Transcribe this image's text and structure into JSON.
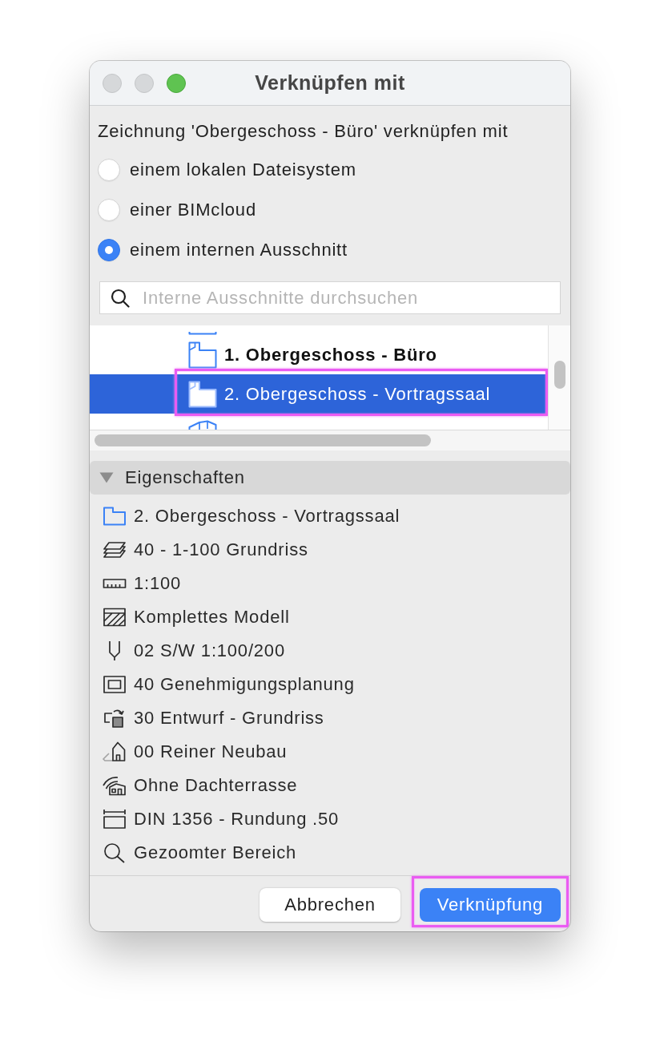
{
  "window": {
    "title": "Verknüpfen mit",
    "buttons": [
      {
        "kind": "close",
        "enabled": false
      },
      {
        "kind": "minimize",
        "enabled": false
      },
      {
        "kind": "zoom",
        "enabled": true
      }
    ]
  },
  "prompt": "Zeichnung 'Obergeschoss - Büro' verknüpfen mit",
  "link_targets": [
    {
      "label": "einem lokalen Dateisystem",
      "selected": false
    },
    {
      "label": "einer BIMcloud",
      "selected": false
    },
    {
      "label": "einem internen Ausschnitt",
      "selected": true
    }
  ],
  "search": {
    "placeholder": "Interne Ausschnitte durchsuchen"
  },
  "tree": {
    "items": [
      {
        "kind": "plan",
        "selected": false,
        "highlighted": false
      },
      {
        "kind": "plan",
        "label": "1. Obergeschoss - Büro",
        "bold": true,
        "selected": false,
        "highlighted": false
      },
      {
        "kind": "plan",
        "label": "2. Obergeschoss - Vortragssaal",
        "bold": false,
        "selected": true,
        "highlighted": true
      },
      {
        "kind": "model",
        "selected": false,
        "highlighted": false
      }
    ]
  },
  "properties": {
    "title": "Eigenschaften",
    "expanded": true,
    "items": [
      {
        "kind": "view",
        "label": "2. Obergeschoss - Vortragssaal"
      },
      {
        "kind": "layers",
        "label": "40 - 1-100 Grundriss"
      },
      {
        "kind": "scale",
        "label": "1:100"
      },
      {
        "kind": "structure",
        "label": "Komplettes Modell"
      },
      {
        "kind": "pens",
        "label": "02 S/W 1:100/200"
      },
      {
        "kind": "model",
        "label": "40 Genehmigungsplanung"
      },
      {
        "kind": "override",
        "label": "30 Entwurf - Grundriss"
      },
      {
        "kind": "renovation",
        "label": "00 Reiner Neubau"
      },
      {
        "kind": "options",
        "label": "Ohne Dachterrasse"
      },
      {
        "kind": "dimensions",
        "label": "DIN 1356 - Rundung .50"
      },
      {
        "kind": "zoom",
        "label": "Gezoomter Bereich"
      }
    ]
  },
  "buttons": [
    {
      "kind": "cancel",
      "label": "Abbrechen",
      "highlighted": false
    },
    {
      "kind": "confirm",
      "label": "Verknüpfung",
      "highlighted": true
    }
  ]
}
